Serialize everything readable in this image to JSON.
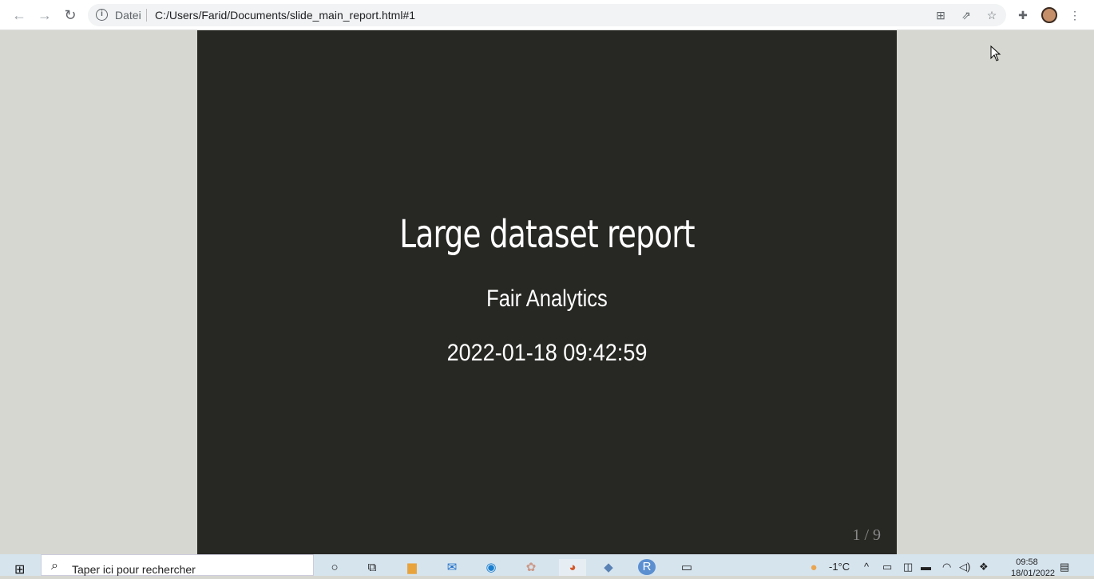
{
  "browser": {
    "info_label": "Datei",
    "url": "C:/Users/Farid/Documents/slide_main_report.html#1"
  },
  "slide": {
    "title": "Large dataset report",
    "author": "Fair Analytics",
    "date": "2022-01-18 09:42:59",
    "page": "1 / 9"
  },
  "taskbar": {
    "search_placeholder": "Taper ici pour rechercher",
    "weather": "-1°C",
    "time": "09:58",
    "date": "18/01/2022"
  }
}
